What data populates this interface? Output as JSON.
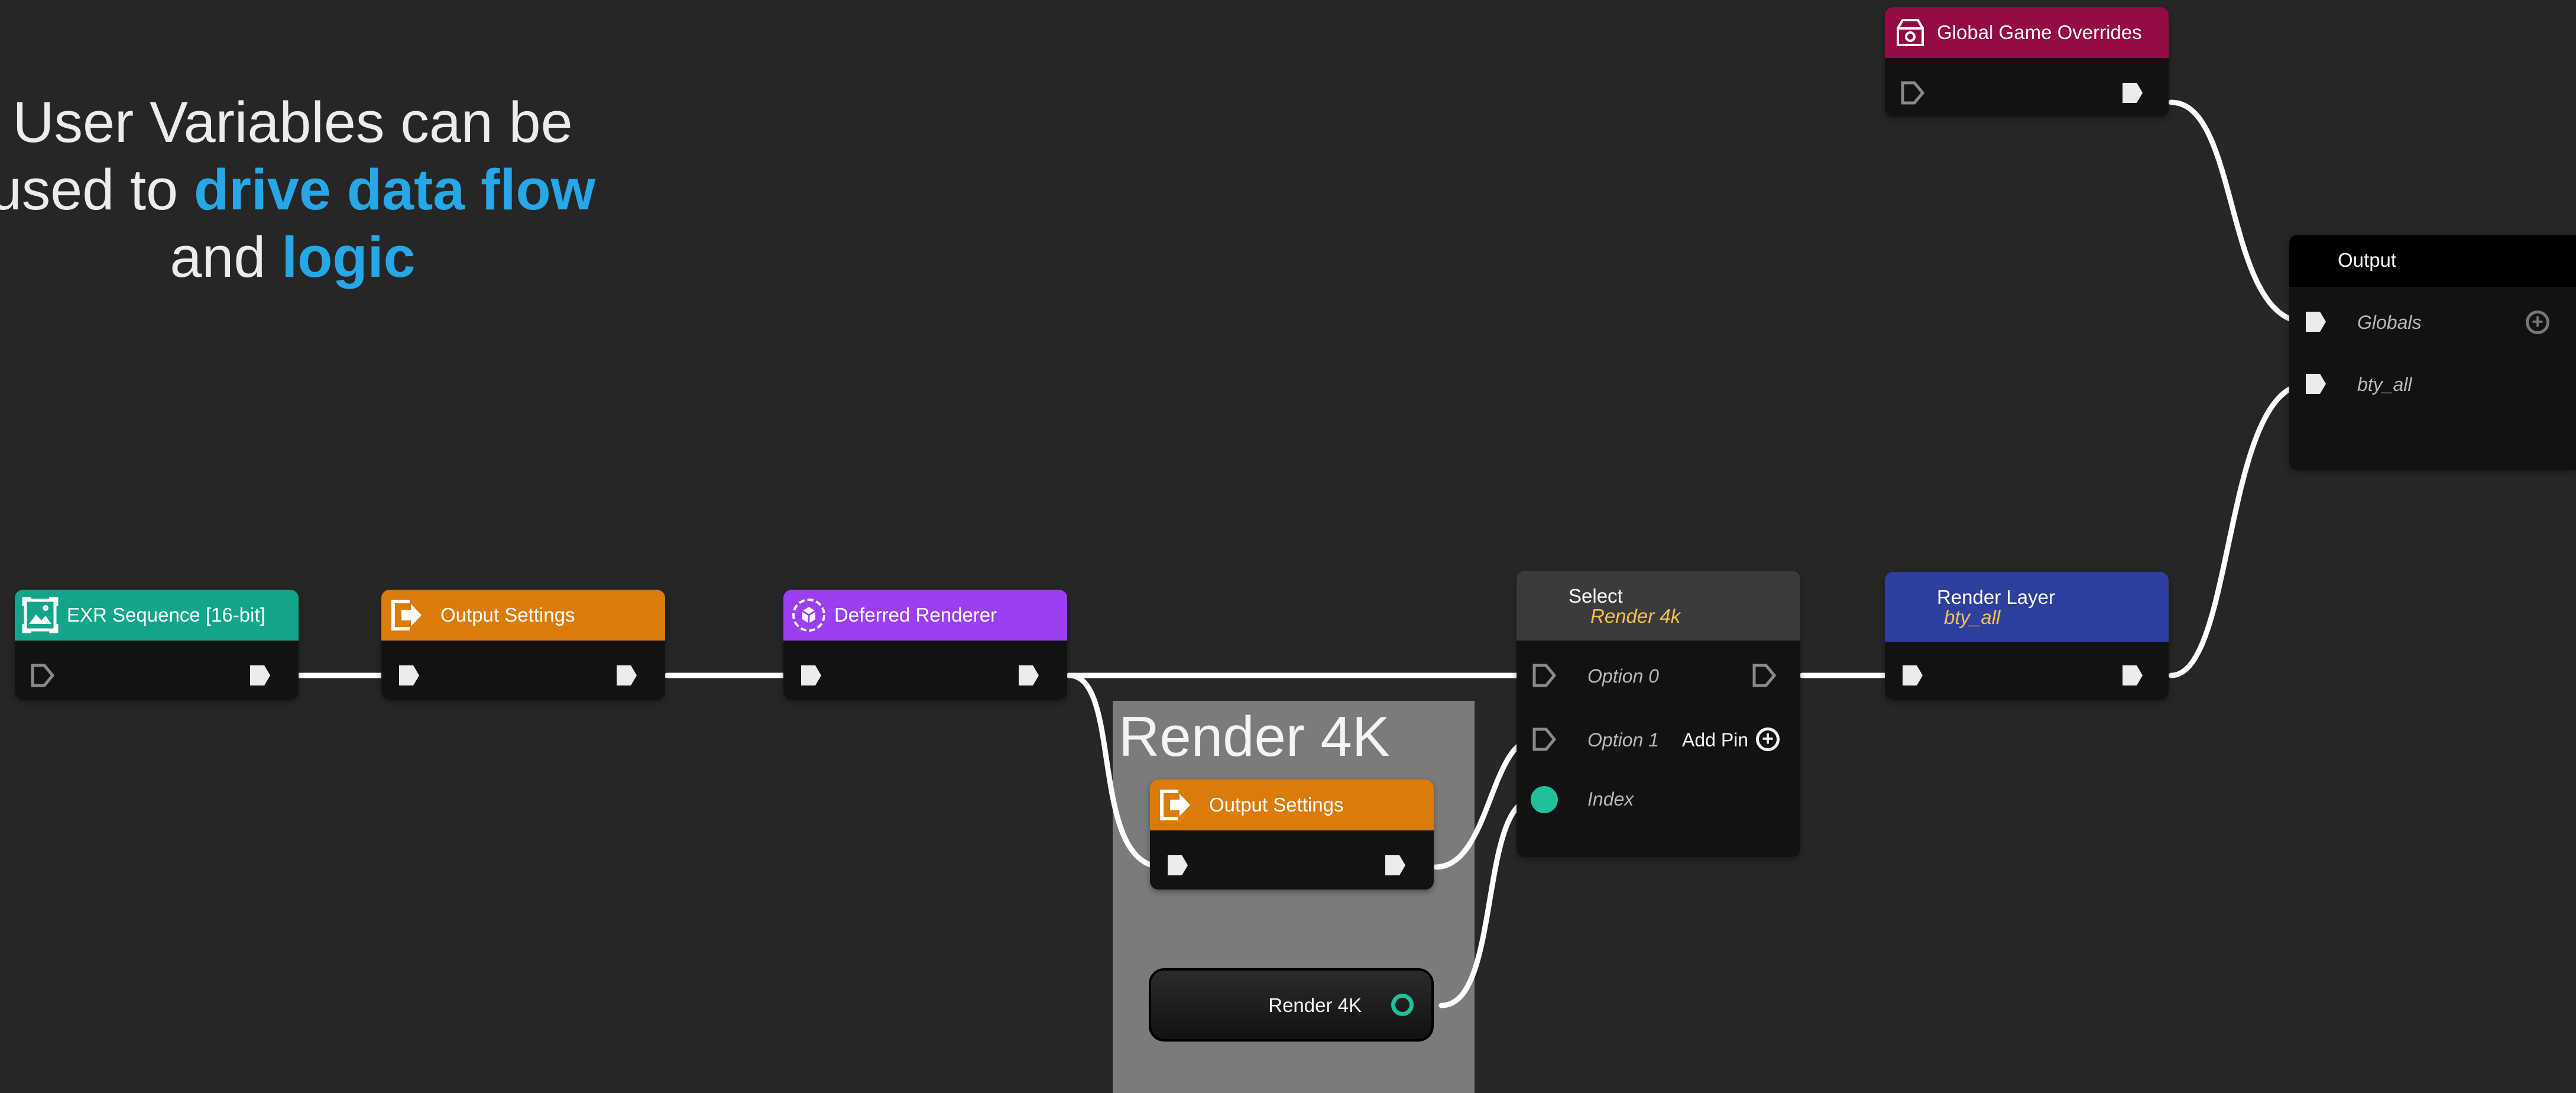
{
  "caption": {
    "line1": "User Variables can be",
    "line2_prefix": "used to ",
    "line2_highlight": "drive data flow",
    "line3_prefix": "and ",
    "line3_highlight": "logic"
  },
  "colors": {
    "canvas": "#262626",
    "highlight": "#26a8e8",
    "exr_header": "#13a58a",
    "output_settings_header": "#db7b0a",
    "deferred_renderer_header": "#9b3ff2",
    "select_header": "#3b3b3b",
    "render_layer_header": "#2f3f9e",
    "global_overrides_header": "#940a45",
    "output_header": "#000000",
    "group_background": "#7b7b7b",
    "variable_pin": "#1fc09a",
    "wire": "#ffffff"
  },
  "group": {
    "title": "Render 4K"
  },
  "nodes": {
    "exr": {
      "title": "EXR Sequence [16-bit]",
      "icon": "image-sequence-icon"
    },
    "output_settings": {
      "title": "Output Settings",
      "icon": "output-settings-icon"
    },
    "deferred_renderer": {
      "title": "Deferred Renderer",
      "icon": "deferred-renderer-icon"
    },
    "output_settings_4k": {
      "title": "Output Settings",
      "icon": "output-settings-icon"
    },
    "select": {
      "title": "Select",
      "subtitle": "Render 4k",
      "pins": [
        "Option 0",
        "Option 1",
        "Index"
      ],
      "add_pin": "Add Pin"
    },
    "render_layer": {
      "title": "Render Layer",
      "subtitle": "bty_all"
    },
    "global_overrides": {
      "title": "Global Game Overrides",
      "icon": "global-overrides-icon"
    },
    "output": {
      "title": "Output",
      "pins": [
        "Globals",
        "bty_all"
      ]
    },
    "variable": {
      "label": "Render 4K"
    }
  }
}
